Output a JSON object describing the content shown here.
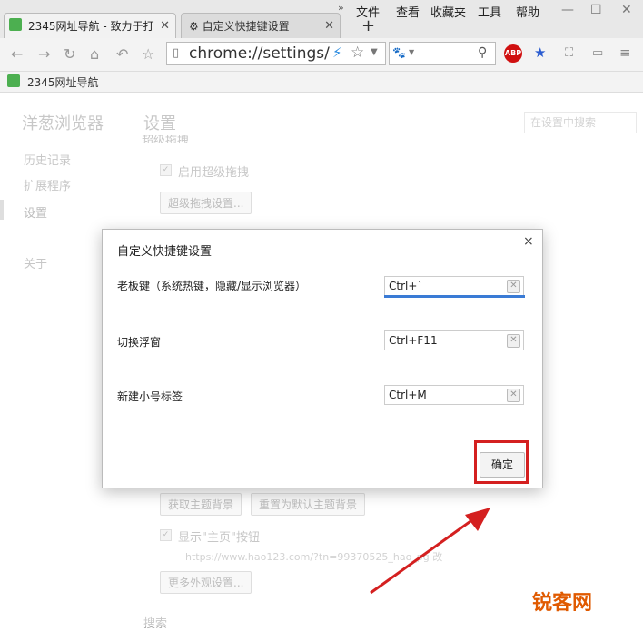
{
  "tabs": [
    {
      "label": "2345网址导航 - 致力于打"
    },
    {
      "label": "自定义快捷键设置"
    }
  ],
  "menu": [
    "文件",
    "查看",
    "收藏夹",
    "工具",
    "帮助"
  ],
  "toolbar": {
    "address": "chrome://settings/ac",
    "abp": "ABP"
  },
  "bookmarks": {
    "item": "2345网址导航"
  },
  "settings": {
    "app_name": "洋葱浏览器",
    "title": "设置",
    "search_placeholder": "在设置中搜索",
    "nav": [
      "历史记录",
      "扩展程序",
      "设置",
      "关于"
    ],
    "section_partial": "超级拖拽",
    "enable_drag": "启用超级拖拽",
    "drag_settings_button": "超级拖拽设置...",
    "get_theme_button": "获取主题背景",
    "reset_theme_button": "重置为默认主题背景",
    "show_home_label": "显示\"主页\"按钮",
    "home_url": "https://www.hao123.com/?tn=99370525_hao_pg  改",
    "more_appearance_button": "更多外观设置...",
    "search_section": "搜索"
  },
  "dialog": {
    "title": "自定义快捷键设置",
    "close": "×",
    "rows": [
      {
        "label": "老板键（系统热键，隐藏/显示浏览器）",
        "value": "Ctrl+`"
      },
      {
        "label": "切换浮窗",
        "value": "Ctrl+F11"
      },
      {
        "label": "新建小号标签",
        "value": "Ctrl+M"
      }
    ],
    "ok": "确定"
  },
  "watermark": "锐客网",
  "colors": {
    "highlight": "#d42020",
    "focus_underline": "#3a7bd5"
  }
}
